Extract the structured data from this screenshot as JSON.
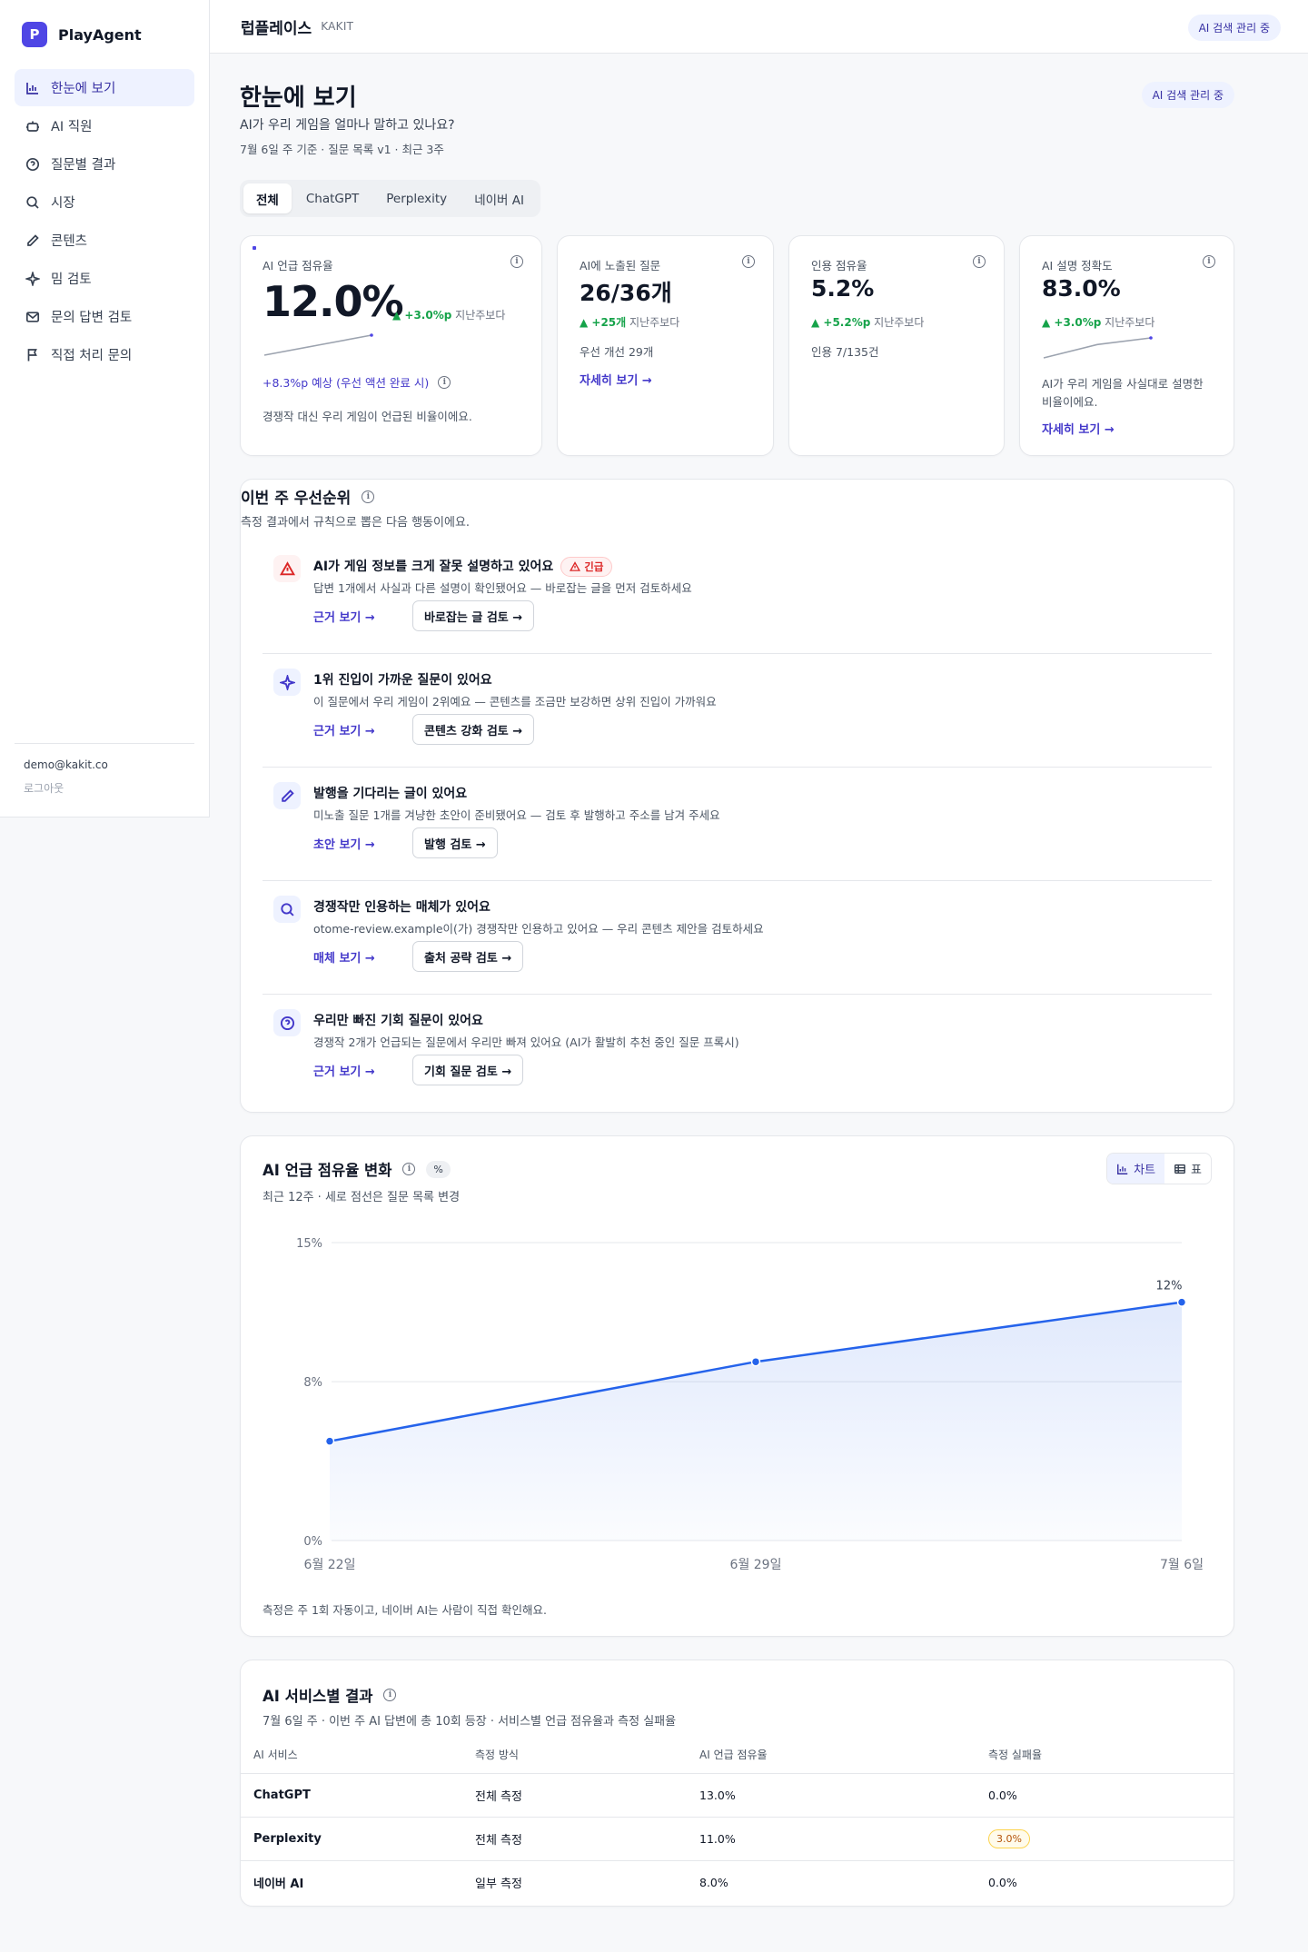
{
  "brand": {
    "logo_letter": "P",
    "name": "PlayAgent"
  },
  "sidebar": {
    "items": [
      {
        "label": "한눈에 보기",
        "icon": "bar-chart-icon",
        "active": true
      },
      {
        "label": "AI 직원",
        "icon": "robot-icon"
      },
      {
        "label": "질문별 결과",
        "icon": "question-circle-icon"
      },
      {
        "label": "시장",
        "icon": "search-icon"
      },
      {
        "label": "콘텐츠",
        "icon": "pencil-icon"
      },
      {
        "label": "밈 검토",
        "icon": "sparkle-icon"
      },
      {
        "label": "문의 답변 검토",
        "icon": "mail-icon"
      },
      {
        "label": "직접 처리 문의",
        "icon": "flag-icon"
      }
    ],
    "email": "demo@kakit.co",
    "logout": "로그아웃"
  },
  "topbar": {
    "title": "럽플레이스",
    "subtitle": "KAKIT",
    "status": "AI 검색 관리 중"
  },
  "page": {
    "title": "한눈에 보기",
    "question": "AI가 우리 게임을 얼마나 말하고 있나요?",
    "meta": "7월 6일 주 기준 · 질문 목록 v1 · 최근 3주",
    "status": "AI 검색 관리 중"
  },
  "tabs": [
    "전체",
    "ChatGPT",
    "Perplexity",
    "네이버 AI"
  ],
  "kpis": {
    "share": {
      "label": "AI 언급 점유율",
      "value": "12.0%",
      "delta": "▲ +3.0%p",
      "delta_suffix": "지난주보다",
      "forecast": "+8.3%p 예상 (우선 액션 완료 시)",
      "desc": "경쟁작 대신 우리 게임이 언급된 비율이에요.",
      "spark": [
        9.0,
        10.5,
        12.0
      ]
    },
    "exposed": {
      "label": "AI에 노출된 질문",
      "value": "26/36개",
      "delta": "▲ +25개",
      "delta_suffix": "지난주보다",
      "note": "우선 개선 29개",
      "link": "자세히 보기 →"
    },
    "citation": {
      "label": "인용 점유율",
      "value": "5.2%",
      "delta": "▲ +5.2%p",
      "delta_suffix": "지난주보다",
      "note": "인용 7/135건"
    },
    "accuracy": {
      "label": "AI 설명 정확도",
      "value": "83.0%",
      "delta": "▲ +3.0%p",
      "delta_suffix": "지난주보다",
      "desc1": "AI가 우리 게임을 사실대로 설명한",
      "desc2": "비율이에요.",
      "link": "자세히 보기 →",
      "spark": [
        80.0,
        82.0,
        83.0
      ]
    }
  },
  "priorities": {
    "title": "이번 주 우선순위",
    "subtitle": "측정 결과에서 규칙으로 뽑은 다음 행동이에요.",
    "items": [
      {
        "icon": "warning-icon",
        "title": "AI가 게임 정보를 크게 잘못 설명하고 있어요",
        "badge": "긴급",
        "desc": "답변 1개에서 사실과 다른 설명이 확인됐어요 — 바로잡는 글을 먼저 검토하세요",
        "link": "근거 보기 →",
        "button": "바로잡는 글 검토 →"
      },
      {
        "icon": "sparkle-icon",
        "title": "1위 진입이 가까운 질문이 있어요",
        "desc": "이 질문에서 우리 게임이 2위예요 — 콘텐츠를 조금만 보강하면 상위 진입이 가까워요",
        "link": "근거 보기 →",
        "button": "콘텐츠 강화 검토 →"
      },
      {
        "icon": "pencil-icon",
        "title": "발행을 기다리는 글이 있어요",
        "desc": "미노출 질문 1개를 겨냥한 초안이 준비됐어요 — 검토 후 발행하고 주소를 남겨 주세요",
        "link": "초안 보기 →",
        "button": "발행 검토 →"
      },
      {
        "icon": "search-icon",
        "title": "경쟁작만 인용하는 매체가 있어요",
        "desc": "otome-review.example이(가) 경쟁작만 인용하고 있어요 — 우리 콘텐츠 제안을 검토하세요",
        "link": "매체 보기 →",
        "button": "출처 공략 검토 →"
      },
      {
        "icon": "question-circle-icon",
        "title": "우리만 빠진 기회 질문이 있어요",
        "desc": "경쟁작 2개가 언급되는 질문에서 우리만 빠져 있어요 (AI가 활발히 추천 중인 질문 프록시)",
        "link": "근거 보기 →",
        "button": "기회 질문 검토 →"
      }
    ]
  },
  "trend": {
    "title": "AI 언급 점유율 변화",
    "unit_badge": "%",
    "subtitle": "최근 12주 · 세로 점선은 질문 목록 변경",
    "toggle": {
      "chart": "차트",
      "table": "표"
    },
    "footnote": "측정은 주 1회 자동이고, 네이버 AI는 사람이 직접 확인해요."
  },
  "chart_data": {
    "type": "area",
    "x": [
      "6월 22일",
      "6월 29일",
      "7월 6일"
    ],
    "values": [
      5.0,
      9.0,
      12.0
    ],
    "yticks": [
      "15%",
      "8%",
      "0%"
    ],
    "ylim": [
      0,
      15
    ],
    "grid": true,
    "data_labels": [
      "",
      "",
      "12%"
    ],
    "color": "#2563eb"
  },
  "services": {
    "title": "AI 서비스별 결과",
    "subtitle": "7월 6일 주 · 이번 주 AI 답변에 총 10회 등장 · 서비스별 언급 점유율과 측정 실패율",
    "columns": [
      "AI 서비스",
      "측정 방식",
      "AI 언급 점유율",
      "측정 실패율"
    ],
    "rows": [
      {
        "service": "ChatGPT",
        "method": "전체 측정",
        "share": "13.0%",
        "fail": "0.0%",
        "fail_highlight": false
      },
      {
        "service": "Perplexity",
        "method": "전체 측정",
        "share": "11.0%",
        "fail": "3.0%",
        "fail_highlight": true
      },
      {
        "service": "네이버 AI",
        "method": "일부 측정",
        "share": "8.0%",
        "fail": "0.0%",
        "fail_highlight": false
      }
    ]
  },
  "colors": {
    "accent": "#4f46e5",
    "positive": "#16a34a",
    "urgent": "#dc2626",
    "line": "#2563eb"
  }
}
